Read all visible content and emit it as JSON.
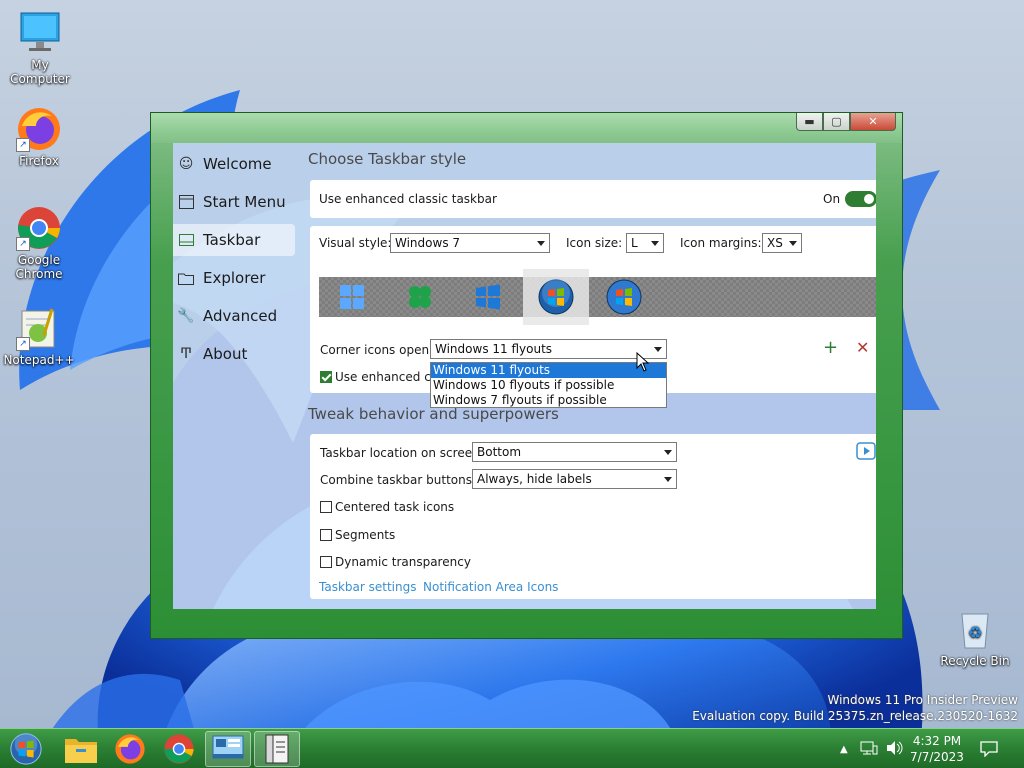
{
  "desktop": {
    "icons": [
      {
        "label": "My Computer",
        "icon": "monitor-icon"
      },
      {
        "label": "Firefox",
        "icon": "firefox-icon"
      },
      {
        "label": "Google Chrome",
        "icon": "chrome-icon"
      },
      {
        "label": "Notepad++",
        "icon": "notepadpp-icon"
      },
      {
        "label": "Recycle Bin",
        "icon": "recycle-bin-icon"
      }
    ],
    "watermark_line1": "Windows 11 Pro Insider Preview",
    "watermark_line2": "Evaluation copy. Build 25375.zn_release.230520-1632"
  },
  "window": {
    "caption_buttons": {
      "minimize": "▬",
      "maximize": "▢",
      "close": "✕"
    },
    "nav": [
      {
        "label": "Welcome",
        "icon": "smile-icon"
      },
      {
        "label": "Start Menu",
        "icon": "start-menu-icon"
      },
      {
        "label": "Taskbar",
        "icon": "taskbar-icon"
      },
      {
        "label": "Explorer",
        "icon": "folder-icon"
      },
      {
        "label": "Advanced",
        "icon": "wrench-icon"
      },
      {
        "label": "About",
        "icon": "about-icon"
      }
    ],
    "page_title": "Choose Taskbar style",
    "enhanced_taskbar": {
      "label": "Use enhanced classic taskbar",
      "state": "On"
    },
    "visual_style": {
      "label": "Visual style:",
      "value": "Windows 7"
    },
    "icon_size": {
      "label": "Icon size:",
      "value": "L"
    },
    "icon_margins": {
      "label": "Icon margins:",
      "value": "XS"
    },
    "styles": [
      "Windows 11 logo",
      "Windows 10 green logo",
      "Windows 10 logo",
      "Windows 7 orb",
      "Windows 7 flag"
    ],
    "corner_icons": {
      "label": "Corner icons open:",
      "value": "Windows 11 flyouts",
      "options": [
        "Windows 11 flyouts",
        "Windows 10 flyouts if possible",
        "Windows 7 flyouts if possible"
      ]
    },
    "enhanced_clas_label": "Use enhanced clas",
    "section2_title": "Tweak behavior and superpowers",
    "taskbar_location": {
      "label": "Taskbar location on screen:",
      "value": "Bottom"
    },
    "combine_buttons": {
      "label": "Combine taskbar buttons:",
      "value": "Always, hide labels"
    },
    "checkboxes": [
      "Centered task icons",
      "Segments",
      "Dynamic transparency"
    ],
    "links": {
      "taskbar_settings": "Taskbar settings",
      "notification_icons": "Notification Area Icons"
    },
    "add_glyph": "+",
    "remove_glyph": "✕"
  },
  "taskbar": {
    "clock_time": "4:32 PM",
    "clock_date": "7/7/2023",
    "apps": [
      "start-orb-icon",
      "file-explorer-icon",
      "firefox-icon",
      "chrome-icon",
      "startallback-icon",
      "notebook-icon"
    ]
  },
  "colors": {
    "accent_green": "#2e7d32",
    "link_blue": "#3a8fd0",
    "highlight": "#1e78d8"
  }
}
